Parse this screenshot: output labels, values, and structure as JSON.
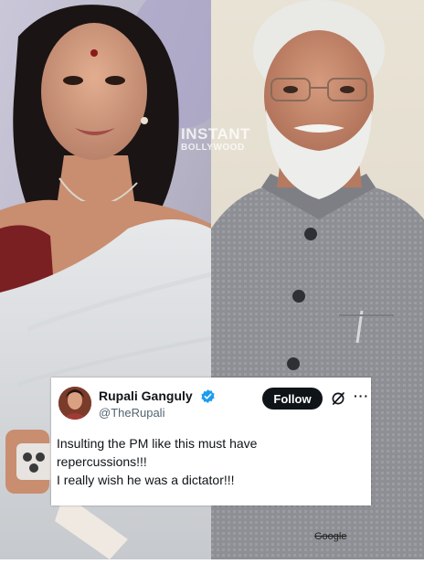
{
  "watermark": {
    "line1": "INSTANT",
    "line2": "BOLLYWOOD"
  },
  "tweet": {
    "display_name": "Rupali Ganguly",
    "verified_icon": "verified-badge-icon",
    "handle": "@TheRupali",
    "follow_label": "Follow",
    "grok_icon": "grok-icon",
    "more_label": "···",
    "text_lines": [
      "Insulting the PM like this must have",
      "repercussions!!!",
      "I really wish he was a dictator!!!"
    ]
  },
  "corner_label": "Google",
  "colors": {
    "verified": "#1d9bf0",
    "follow_bg": "#0f1419",
    "text": "#0f1419",
    "handle": "#536471"
  }
}
